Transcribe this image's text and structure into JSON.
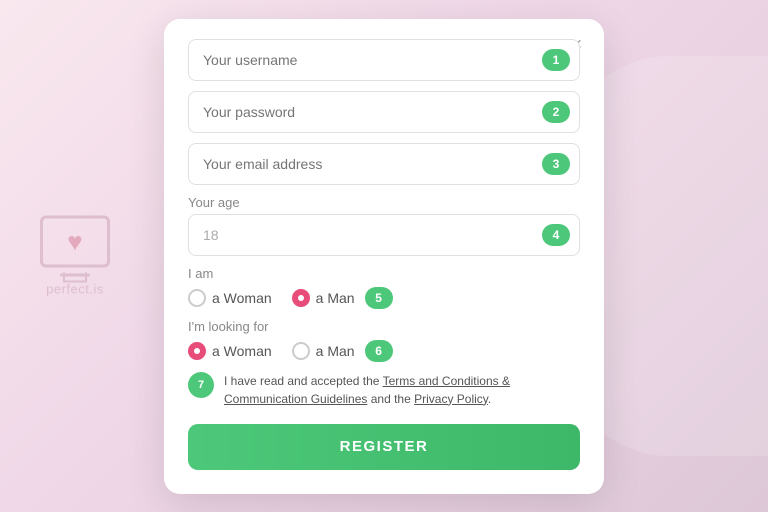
{
  "watermark": {
    "site_name": "perfect.is"
  },
  "modal": {
    "close_label": "×",
    "fields": {
      "username_placeholder": "Your username",
      "password_placeholder": "Your password",
      "email_placeholder": "Your email address",
      "age_label": "Your age",
      "age_value": "18"
    },
    "steps": {
      "step1": "1",
      "step2": "2",
      "step3": "3",
      "step4": "4",
      "step5": "5",
      "step6": "6",
      "step7": "7"
    },
    "i_am": {
      "label": "I am",
      "option_woman": "a Woman",
      "option_man": "a Man",
      "selected": "man"
    },
    "looking_for": {
      "label": "I'm looking for",
      "option_woman": "a Woman",
      "option_man": "a Man",
      "selected": "woman"
    },
    "terms": {
      "text_before": "I have read and accepted the ",
      "link1": "Terms and Conditions & Communication Guidelines",
      "text_middle": " and the ",
      "link2": "Privacy Policy",
      "text_after": "."
    },
    "register_button": "REGISTER"
  }
}
